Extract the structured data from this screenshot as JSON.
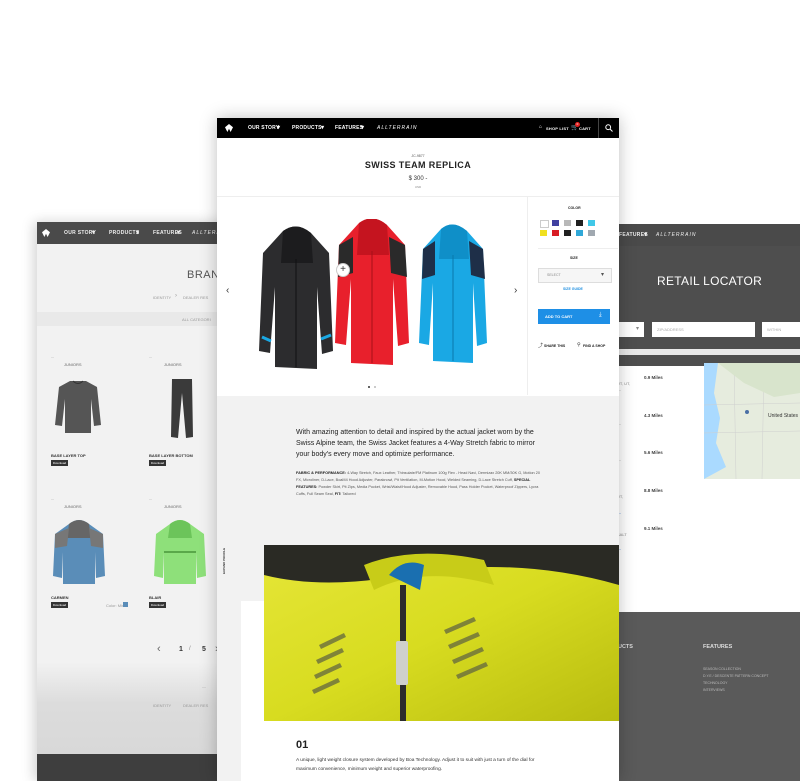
{
  "left_page": {
    "nav": {
      "our_story": "OUR STORY",
      "products": "PRODUCTS",
      "features": "FEATURES",
      "logo_text": "ALLTERRAIN"
    },
    "title": "BRAND",
    "subnav": [
      "IDENTITY",
      "DEALER RES"
    ],
    "breadcrumb": "ALL    CATEGORI",
    "products": [
      {
        "brand": "JUNIORS",
        "name": "BASE LAYER TOP",
        "button": "Download"
      },
      {
        "brand": "JUNIORS",
        "name": "BASE LAYER BOTTOM",
        "button": "Download"
      },
      {
        "brand": "JUNIORS",
        "name": "CARMEN",
        "button": "Download",
        "extra": "Color: Mini"
      },
      {
        "brand": "JUNIORS",
        "name": "BLAIR",
        "button": "Download"
      }
    ],
    "pagination": {
      "prev": "‹",
      "current": "1",
      "sep": "/",
      "total": "5",
      "next": "›"
    },
    "footer_links": [
      "IDENTITY",
      "DEALER RES"
    ]
  },
  "right_page": {
    "nav": {
      "features": "FEATURES",
      "logo_text": "ALLTERRAIN"
    },
    "title": "RETAIL LOCATOR",
    "inputs": {
      "zip": "ZIP/ADDRESS",
      "radius": "WITHIN"
    },
    "map_label": "United States",
    "stores": [
      {
        "dist": "0.9 Miles",
        "line": "UT, UT,"
      },
      {
        "dist": "4.3 Miles",
        "line": ""
      },
      {
        "dist": "5.6 Miles",
        "line": ""
      },
      {
        "dist": "8.8 Miles",
        "line": "UT,"
      },
      {
        "dist": "9.1 Miles",
        "line": "SALT"
      }
    ],
    "footer": {
      "col1_title": "DUCTS",
      "col2_title": "FEATURES",
      "col2_links": [
        "SEASON COLLECTION",
        "D.Y.E / DESCENTE PATTERN CONCEPT",
        "TECHNOLOGY",
        "INTERVIEWS"
      ]
    }
  },
  "center_page": {
    "nav": {
      "our_story": "OUR STORY",
      "products": "PRODUCTS",
      "features": "FEATURES",
      "logo_text": "ALLTERRAIN",
      "shop_list": "SHOP LIST",
      "cart": "CART",
      "cart_count": "0"
    },
    "product": {
      "tag": "JC-9877",
      "title": "SWISS TEAM REPLICA",
      "price": "$ 300 -",
      "price_note": "USD"
    },
    "options": {
      "color_label": "COLOR",
      "colors": [
        "#ffffff",
        "#4040a0",
        "#b8b8b8",
        "#202020",
        "#40c8e8",
        "#f0e020",
        "#d81c24",
        "#202020",
        "#30a8d8",
        "#a0a8b0"
      ],
      "size_label": "SIZE",
      "size_value": "SELECT",
      "size_guide": "SIZE GUIDE",
      "add_to_cart": "ADD TO CART",
      "share": "SHARE THIS",
      "find_shop": "FIND A SHOP"
    },
    "description": "With amazing attention to detail and inspired by the actual jacket worn by the Swiss Alpine team, the Swiss Jacket features a 4-Way Stretch fabric to mirror your body's every move and optimize performance.",
    "specs": {
      "fp_label": "FABRIC & PERFORMANCE:",
      "fp_text": "4-Way Stretch,  Faux Leather,  Thinsulate/FM Platinum 100g Flex - Head Navi,  Dermizax 20K MM/30K G, Motion 20 FX,  Microliner,  D-Lace,  BoaM4 Hood Adjuster,  Paraknowl,  Pit Ventilation,  M-Motion Hood,  Welded Seaming,  D-Lace Stretch Cuff,",
      "sf_label": "SPECIAL FEATURES:",
      "sf_text": "Powder Skirt,  Pit Zips,  Media Pocket,  Wrist/Waist/Hood Adjuster,  Removable Hood,  Pass Holder Pocket, Waterproof Zippers,  Lycra Cuffs,  Full Seam Seal,",
      "fit_label": "FIT:",
      "fit_text": "Tailored"
    },
    "side_label": "EXPAND PROFILE",
    "feature": {
      "number": "01",
      "text": "A unique, light weight closure system developed by Boa Technology. Adjust it to suit with just a turn of the dial for maximum convenience, minimum weight and superior waterproofing."
    }
  }
}
